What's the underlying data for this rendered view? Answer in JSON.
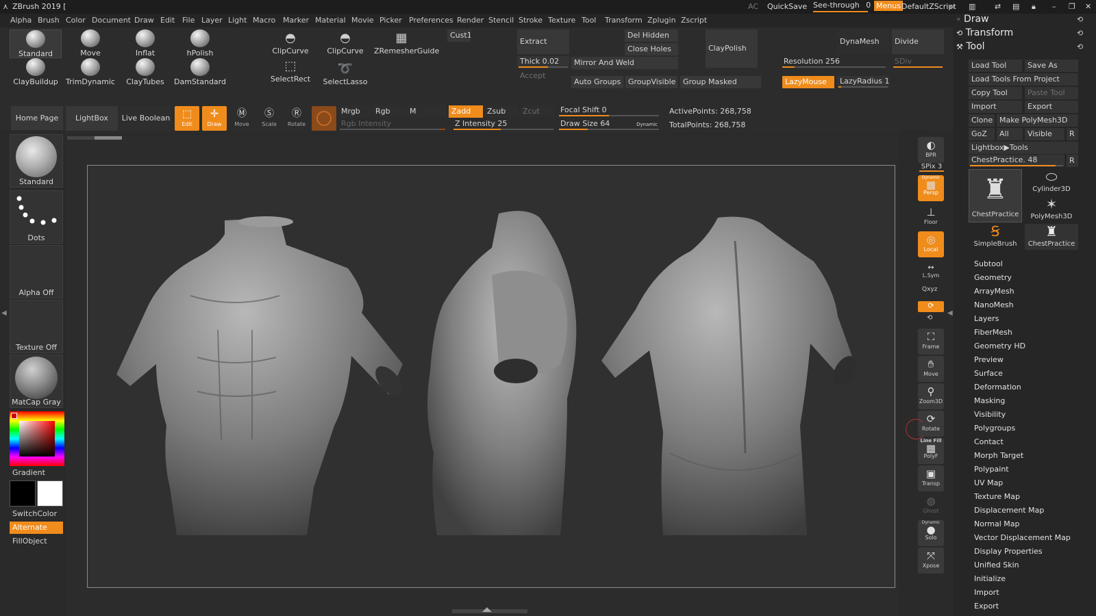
{
  "titlebar": {
    "app_title": "ZBrush 2019 [",
    "ac": "AC",
    "quicksave": "QuickSave",
    "see_through_label": "See-through",
    "see_through_value": "0",
    "menus": "Menus",
    "default_zscript": "DefaultZScript"
  },
  "menu": [
    "Alpha",
    "Brush",
    "Color",
    "Document",
    "Draw",
    "Edit",
    "File",
    "Layer",
    "Light",
    "Macro",
    "Marker",
    "Material",
    "Movie",
    "Picker",
    "Preferences",
    "Render",
    "Stencil",
    "Stroke",
    "Texture",
    "Tool",
    "Transform",
    "Zplugin",
    "Zscript"
  ],
  "shelf": {
    "brushes_row1": [
      "Standard",
      "Move",
      "Inflat",
      "hPolish"
    ],
    "brushes_row2": [
      "ClayBuildup",
      "TrimDynamic",
      "ClayTubes",
      "DamStandard"
    ],
    "clip_curve_1": "ClipCurve",
    "clip_curve_2": "ClipCurve",
    "zremesher": "ZRemesherGuide",
    "select_rect": "SelectRect",
    "select_lasso": "SelectLasso",
    "cust1": "Cust1",
    "extract": "Extract",
    "thick": "Thick",
    "thick_value": "0.02",
    "accept": "Accept",
    "del_hidden": "Del Hidden",
    "close_holes": "Close Holes",
    "mirror_and_weld": "Mirror And Weld",
    "auto_groups": "Auto Groups",
    "group_visible": "GroupVisible",
    "group_masked": "Group Masked",
    "clay_polish": "ClayPolish",
    "dynamesh": "DynaMesh",
    "divide": "Divide",
    "resolution": "Resolution",
    "resolution_value": "256",
    "sdiv": "SDiv",
    "lazymouse": "LazyMouse",
    "lazyradius": "LazyRadius",
    "lazyradius_value": "1"
  },
  "toolbar2": {
    "home_page": "Home Page",
    "lightbox": "LightBox",
    "live_boolean": "Live Boolean",
    "edit": "Edit",
    "draw": "Draw",
    "move": "Move",
    "scale": "Scale",
    "rotate": "Rotate",
    "mrgb": "Mrgb",
    "rgb": "Rgb",
    "m": "M",
    "rgb_intensity": "Rgb Intensity",
    "zadd": "Zadd",
    "zsub": "Zsub",
    "zcut": "Zcut",
    "z_intensity": "Z Intensity",
    "z_intensity_value": "25",
    "focal_shift": "Focal Shift",
    "focal_shift_value": "0",
    "draw_size": "Draw Size",
    "draw_size_value": "64",
    "dynamic": "Dynamic",
    "active_points": "ActivePoints: 268,758",
    "total_points": "TotalPoints: 268,758"
  },
  "leftshelf": {
    "brush": "Standard",
    "stroke": "Dots",
    "alpha": "Alpha Off",
    "texture": "Texture Off",
    "material": "MatCap Gray",
    "gradient": "Gradient",
    "switch_color": "SwitchColor",
    "alternate": "Alternate",
    "fill_object": "FillObject"
  },
  "rightdock": {
    "bpr": "BPR",
    "spix": "SPix 3",
    "persp": "Persp",
    "persp_top": "Dynamic",
    "floor": "Floor",
    "local": "Local",
    "lsym": "L.Sym",
    "xyz": "Qxyz",
    "frame": "Frame",
    "move": "Move",
    "zoom3d": "Zoom3D",
    "rotate": "Rotate",
    "line_fill": "Line Fill",
    "polyf": "PolyF",
    "transp": "Transp",
    "ghost": "Ghost",
    "solo": "Solo",
    "solo_top": "Dynamic",
    "xpose": "Xpose"
  },
  "tray": {
    "draw": "Draw",
    "transform": "Transform",
    "tool": "Tool",
    "load_tool": "Load Tool",
    "save_as": "Save As",
    "load_from_project": "Load Tools From Project",
    "copy_tool": "Copy Tool",
    "paste_tool": "Paste Tool",
    "import": "Import",
    "export": "Export",
    "clone": "Clone",
    "make_polymesh": "Make PolyMesh3D",
    "goz": "GoZ",
    "all": "All",
    "visible": "Visible",
    "r": "R",
    "lightbox_tools": "Lightbox▶Tools",
    "chest_slider": "ChestPractice. 48",
    "thumbs": [
      "ChestPractice",
      "Cylinder3D",
      "PolyMesh3D",
      "SimpleBrush",
      "ChestPractice"
    ],
    "subpalettes": [
      "Subtool",
      "Geometry",
      "ArrayMesh",
      "NanoMesh",
      "Layers",
      "FiberMesh",
      "Geometry HD",
      "Preview",
      "Surface",
      "Deformation",
      "Masking",
      "Visibility",
      "Polygroups",
      "Contact",
      "Morph Target",
      "Polypaint",
      "UV Map",
      "Texture Map",
      "Displacement Map",
      "Normal Map",
      "Vector Displacement Map",
      "Display Properties",
      "Unified Skin",
      "Initialize",
      "Import",
      "Export"
    ]
  },
  "colors": {
    "accent": "#f08c1c",
    "bg": "#2a2a2a",
    "panel": "#383838"
  }
}
